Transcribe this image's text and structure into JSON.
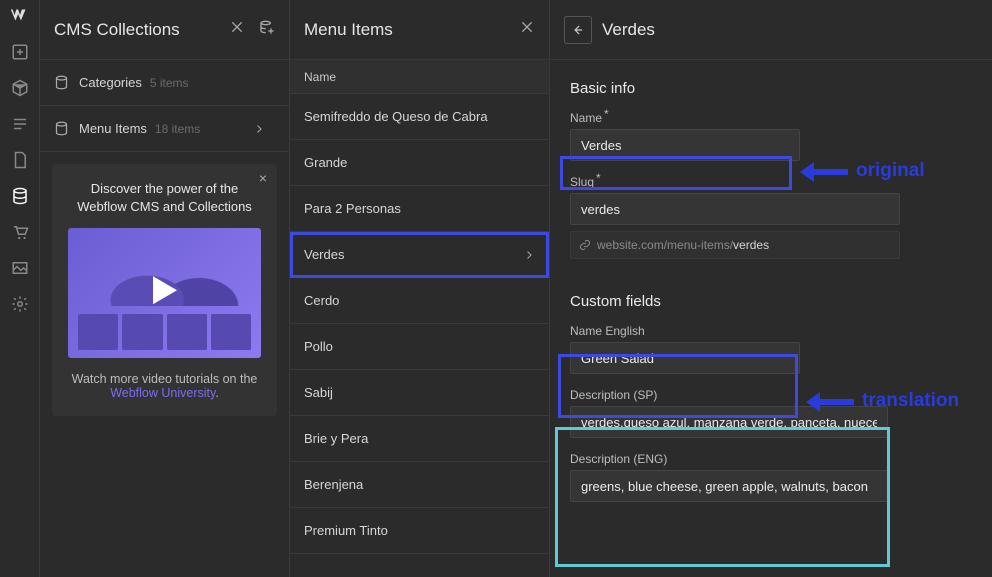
{
  "sidebar": {
    "icons": [
      "logo",
      "add",
      "box",
      "lines",
      "page",
      "database",
      "cart",
      "image",
      "gear"
    ],
    "active": "database"
  },
  "panelA": {
    "title": "CMS Collections",
    "collections": [
      {
        "name": "Categories",
        "count": "5 items",
        "expanded": false
      },
      {
        "name": "Menu Items",
        "count": "18 items",
        "expanded": true
      }
    ],
    "promo": {
      "headline": "Discover the power of the Webflow CMS and Collections",
      "footer_pre": "Watch more video tutorials on the ",
      "footer_link": "Webflow University",
      "footer_post": "."
    }
  },
  "panelB": {
    "title": "Menu Items",
    "column_header": "Name",
    "items": [
      "Semifreddo de Queso de Cabra",
      "Grande",
      "Para 2 Personas",
      "Verdes",
      "Cerdo",
      "Pollo",
      "Sabij",
      "Brie y Pera",
      "Berenjena",
      "Premium Tinto"
    ],
    "selected": "Verdes"
  },
  "panelC": {
    "title": "Verdes",
    "basic_info_label": "Basic info",
    "name_label": "Name",
    "name_value": "Verdes",
    "slug_label": "Slug",
    "slug_value": "verdes",
    "url_prefix": "website.com/menu-items/",
    "url_slug": "verdes",
    "custom_fields_label": "Custom fields",
    "name_en_label": "Name English",
    "name_en_value": "Green Salad",
    "desc_sp_label": "Description (SP)",
    "desc_sp_value": "verdes,queso azul, manzana verde, panceta, nueces",
    "desc_en_label": "Description (ENG)",
    "desc_en_value": "greens, blue cheese, green apple, walnuts, bacon"
  },
  "annotations": {
    "original": "original",
    "translation": "translation"
  }
}
